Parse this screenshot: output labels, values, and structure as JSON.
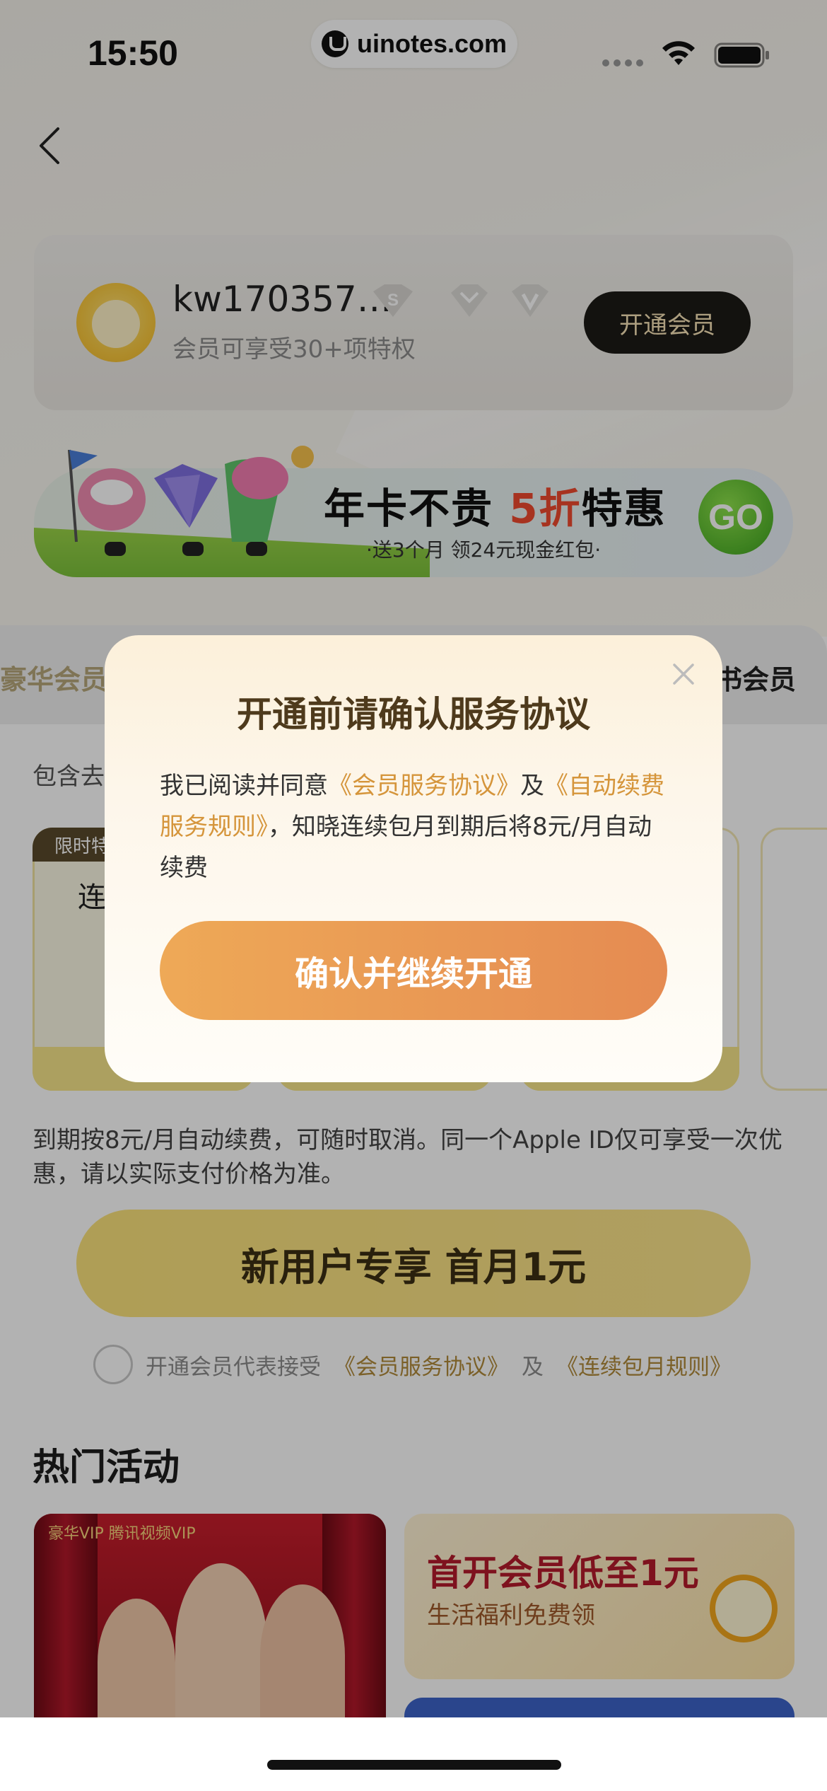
{
  "status_bar": {
    "time": "15:50",
    "url": "uinotes.com"
  },
  "member_card": {
    "username": "kw170357…",
    "subtitle": "会员可享受30+项特权",
    "open_button": "开通会员"
  },
  "promo_banner": {
    "title_prefix": "年卡不贵 ",
    "title_highlight": "5折",
    "title_suffix": "特惠",
    "subtitle": "·送3个月 领24元现金红包·",
    "go_label": "GO"
  },
  "plans": {
    "tab_left": "豪华会员",
    "tab_right": "书会员",
    "includes_prefix": "包含去",
    "tag": "限时特",
    "first_plan_name": "连"
  },
  "renew_note": "到期按8元/月自动续费，可随时取消。同一个Apple ID仅可享受一次优惠，请以实际支付价格为准。",
  "cta": {
    "label": "新用户专享 首月1元"
  },
  "agreement": {
    "prefix": "开通会员代表接受",
    "link1": "《会员服务协议》",
    "and": "及",
    "link2": "《连续包月规则》"
  },
  "hot": {
    "title": "热门活动",
    "left_vip_strip": "豪华VIP  腾讯视频VIP",
    "right_title": "首开会员低至1元",
    "right_subtitle": "生活福利免费领"
  },
  "dialog": {
    "title": "开通前请确认服务协议",
    "body_prefix": "我已阅读并同意",
    "link1": "《会员服务协议》",
    "and": "及",
    "link2": "《自动续费服务规则》",
    "body_suffix": "，知晓连续包月到期后将8元/月自动续费",
    "confirm_button": "确认并继续开通"
  },
  "colors": {
    "accent_gold": "#d5953b",
    "confirm_gradient_start": "#eea957",
    "confirm_gradient_end": "#e58b52",
    "cta_yellow": "#fbe27b",
    "dim_overlay": "rgba(0,0,0,0.30)"
  },
  "icons": {
    "back": "chevron-left-icon",
    "close": "close-icon",
    "wifi": "wifi-icon",
    "battery": "battery-icon"
  }
}
